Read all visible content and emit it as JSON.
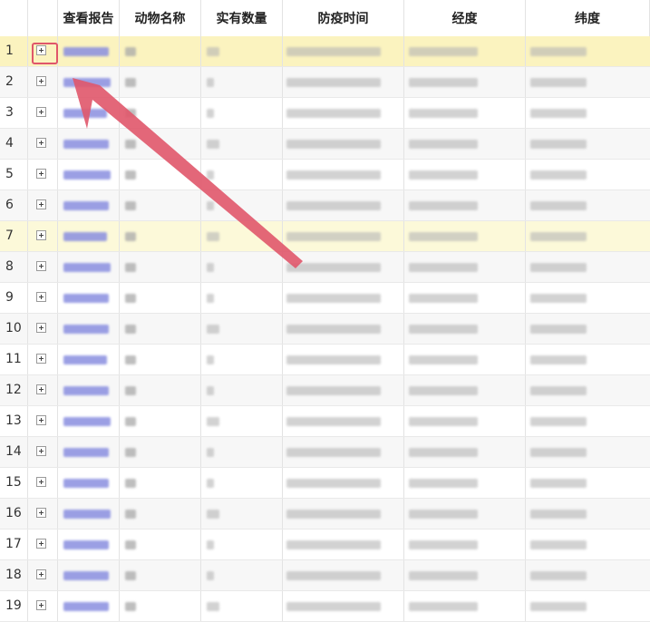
{
  "headers": {
    "row_number": "",
    "expand": "",
    "view_report": "查看报告",
    "animal_name": "动物名称",
    "actual_count": "实有数量",
    "vaccination_time": "防疫时间",
    "longitude": "经度",
    "latitude": "纬度"
  },
  "rows": [
    {
      "num": "1"
    },
    {
      "num": "2"
    },
    {
      "num": "3"
    },
    {
      "num": "4"
    },
    {
      "num": "5"
    },
    {
      "num": "6"
    },
    {
      "num": "7"
    },
    {
      "num": "8"
    },
    {
      "num": "9"
    },
    {
      "num": "10"
    },
    {
      "num": "11"
    },
    {
      "num": "12"
    },
    {
      "num": "13"
    },
    {
      "num": "14"
    },
    {
      "num": "15"
    },
    {
      "num": "16"
    },
    {
      "num": "17"
    },
    {
      "num": "18"
    },
    {
      "num": "19"
    }
  ],
  "selected_row": "1",
  "highlighted_row": "7",
  "icons": {
    "expand": "plus-square-icon"
  },
  "colors": {
    "annotation": "#e0566a",
    "selected_row_bg": "#fbf3bf",
    "link_text": "#8a8fe0"
  }
}
